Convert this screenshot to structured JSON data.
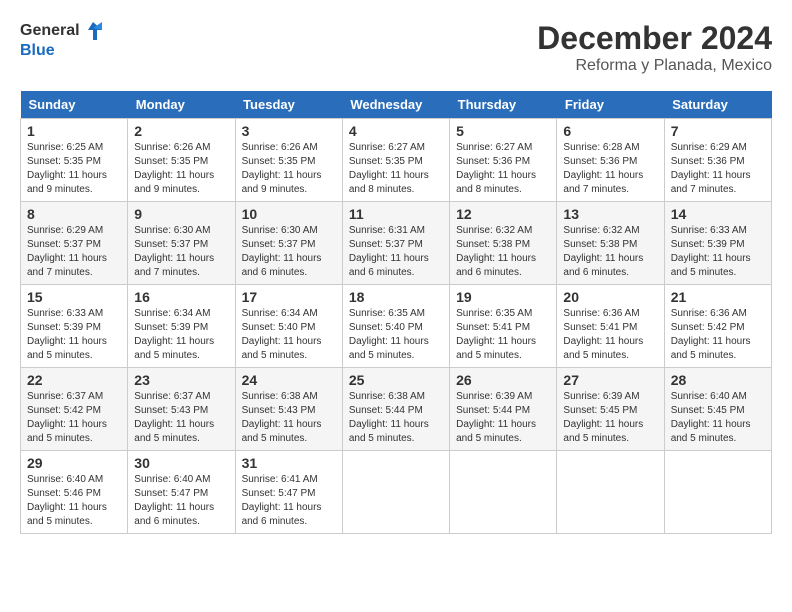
{
  "logo": {
    "general": "General",
    "blue": "Blue"
  },
  "header": {
    "month": "December 2024",
    "location": "Reforma y Planada, Mexico"
  },
  "weekdays": [
    "Sunday",
    "Monday",
    "Tuesday",
    "Wednesday",
    "Thursday",
    "Friday",
    "Saturday"
  ],
  "weeks": [
    [
      {
        "day": "1",
        "sunrise": "6:25 AM",
        "sunset": "5:35 PM",
        "daylight": "11 hours and 9 minutes."
      },
      {
        "day": "2",
        "sunrise": "6:26 AM",
        "sunset": "5:35 PM",
        "daylight": "11 hours and 9 minutes."
      },
      {
        "day": "3",
        "sunrise": "6:26 AM",
        "sunset": "5:35 PM",
        "daylight": "11 hours and 9 minutes."
      },
      {
        "day": "4",
        "sunrise": "6:27 AM",
        "sunset": "5:35 PM",
        "daylight": "11 hours and 8 minutes."
      },
      {
        "day": "5",
        "sunrise": "6:27 AM",
        "sunset": "5:36 PM",
        "daylight": "11 hours and 8 minutes."
      },
      {
        "day": "6",
        "sunrise": "6:28 AM",
        "sunset": "5:36 PM",
        "daylight": "11 hours and 7 minutes."
      },
      {
        "day": "7",
        "sunrise": "6:29 AM",
        "sunset": "5:36 PM",
        "daylight": "11 hours and 7 minutes."
      }
    ],
    [
      {
        "day": "8",
        "sunrise": "6:29 AM",
        "sunset": "5:37 PM",
        "daylight": "11 hours and 7 minutes."
      },
      {
        "day": "9",
        "sunrise": "6:30 AM",
        "sunset": "5:37 PM",
        "daylight": "11 hours and 7 minutes."
      },
      {
        "day": "10",
        "sunrise": "6:30 AM",
        "sunset": "5:37 PM",
        "daylight": "11 hours and 6 minutes."
      },
      {
        "day": "11",
        "sunrise": "6:31 AM",
        "sunset": "5:37 PM",
        "daylight": "11 hours and 6 minutes."
      },
      {
        "day": "12",
        "sunrise": "6:32 AM",
        "sunset": "5:38 PM",
        "daylight": "11 hours and 6 minutes."
      },
      {
        "day": "13",
        "sunrise": "6:32 AM",
        "sunset": "5:38 PM",
        "daylight": "11 hours and 6 minutes."
      },
      {
        "day": "14",
        "sunrise": "6:33 AM",
        "sunset": "5:39 PM",
        "daylight": "11 hours and 5 minutes."
      }
    ],
    [
      {
        "day": "15",
        "sunrise": "6:33 AM",
        "sunset": "5:39 PM",
        "daylight": "11 hours and 5 minutes."
      },
      {
        "day": "16",
        "sunrise": "6:34 AM",
        "sunset": "5:39 PM",
        "daylight": "11 hours and 5 minutes."
      },
      {
        "day": "17",
        "sunrise": "6:34 AM",
        "sunset": "5:40 PM",
        "daylight": "11 hours and 5 minutes."
      },
      {
        "day": "18",
        "sunrise": "6:35 AM",
        "sunset": "5:40 PM",
        "daylight": "11 hours and 5 minutes."
      },
      {
        "day": "19",
        "sunrise": "6:35 AM",
        "sunset": "5:41 PM",
        "daylight": "11 hours and 5 minutes."
      },
      {
        "day": "20",
        "sunrise": "6:36 AM",
        "sunset": "5:41 PM",
        "daylight": "11 hours and 5 minutes."
      },
      {
        "day": "21",
        "sunrise": "6:36 AM",
        "sunset": "5:42 PM",
        "daylight": "11 hours and 5 minutes."
      }
    ],
    [
      {
        "day": "22",
        "sunrise": "6:37 AM",
        "sunset": "5:42 PM",
        "daylight": "11 hours and 5 minutes."
      },
      {
        "day": "23",
        "sunrise": "6:37 AM",
        "sunset": "5:43 PM",
        "daylight": "11 hours and 5 minutes."
      },
      {
        "day": "24",
        "sunrise": "6:38 AM",
        "sunset": "5:43 PM",
        "daylight": "11 hours and 5 minutes."
      },
      {
        "day": "25",
        "sunrise": "6:38 AM",
        "sunset": "5:44 PM",
        "daylight": "11 hours and 5 minutes."
      },
      {
        "day": "26",
        "sunrise": "6:39 AM",
        "sunset": "5:44 PM",
        "daylight": "11 hours and 5 minutes."
      },
      {
        "day": "27",
        "sunrise": "6:39 AM",
        "sunset": "5:45 PM",
        "daylight": "11 hours and 5 minutes."
      },
      {
        "day": "28",
        "sunrise": "6:40 AM",
        "sunset": "5:45 PM",
        "daylight": "11 hours and 5 minutes."
      }
    ],
    [
      {
        "day": "29",
        "sunrise": "6:40 AM",
        "sunset": "5:46 PM",
        "daylight": "11 hours and 5 minutes."
      },
      {
        "day": "30",
        "sunrise": "6:40 AM",
        "sunset": "5:47 PM",
        "daylight": "11 hours and 6 minutes."
      },
      {
        "day": "31",
        "sunrise": "6:41 AM",
        "sunset": "5:47 PM",
        "daylight": "11 hours and 6 minutes."
      },
      null,
      null,
      null,
      null
    ]
  ]
}
